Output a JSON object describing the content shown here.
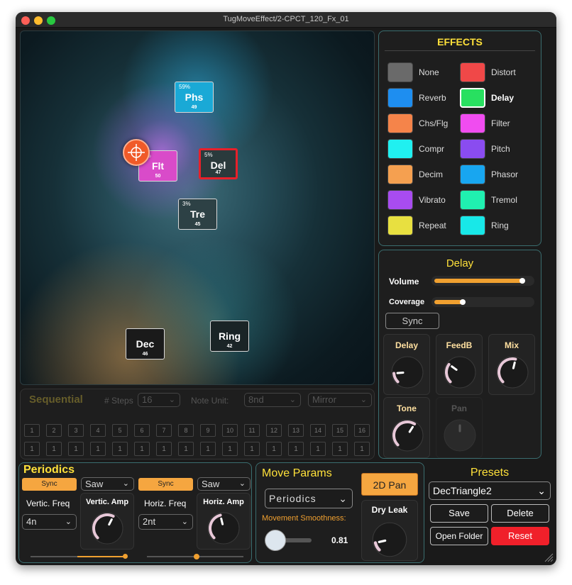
{
  "window": {
    "title": "TugMoveEffect/2-CPCT_120_Fx_01"
  },
  "tiles": [
    {
      "name": "Phs",
      "pct": "59%",
      "num": "49",
      "color": "#1aa9d6"
    },
    {
      "name": "Flt",
      "pct": "3%",
      "num": "50",
      "color": "#d94bc9"
    },
    {
      "name": "Del",
      "pct": "5%",
      "num": "47",
      "color": "#2a3a3c"
    },
    {
      "name": "Tre",
      "pct": "3%",
      "num": "45",
      "color": "#2d4145"
    },
    {
      "name": "Dec",
      "pct": "",
      "num": "46",
      "color": "#1a1a1a"
    },
    {
      "name": "Ring",
      "pct": "",
      "num": "42",
      "color": "#1a2426"
    }
  ],
  "effects": {
    "title": "EFFECTS",
    "items": [
      {
        "label": "None",
        "color": "#6a6a6a"
      },
      {
        "label": "Distort",
        "color": "#f04848"
      },
      {
        "label": "Reverb",
        "color": "#1e8ef0"
      },
      {
        "label": "Delay",
        "color": "#28e060",
        "selected": true
      },
      {
        "label": "Chs/Flg",
        "color": "#f5844a"
      },
      {
        "label": "Filter",
        "color": "#f04cf0"
      },
      {
        "label": "Compr",
        "color": "#20f0f0"
      },
      {
        "label": "Pitch",
        "color": "#8a4cf0"
      },
      {
        "label": "Decim",
        "color": "#f5a050"
      },
      {
        "label": "Phasor",
        "color": "#18a6f0"
      },
      {
        "label": "Vibrato",
        "color": "#a84cf0"
      },
      {
        "label": "Tremol",
        "color": "#20f0b0"
      },
      {
        "label": "Repeat",
        "color": "#e8e040"
      },
      {
        "label": "Ring",
        "color": "#18e8e8"
      }
    ]
  },
  "delay": {
    "title": "Delay",
    "volume_label": "Volume",
    "volume": 0.93,
    "coverage_label": "Coverage",
    "coverage": 0.3,
    "sync_label": "Sync",
    "knobs": [
      {
        "label": "Delay",
        "value": 0.15
      },
      {
        "label": "FeedB",
        "value": 0.3
      },
      {
        "label": "Mix",
        "value": 0.55
      },
      {
        "label": "Tone",
        "value": 0.62
      },
      {
        "label": "Pan",
        "value": 0.5
      }
    ]
  },
  "sequential": {
    "title": "Sequential",
    "steps_label": "# Steps",
    "steps_value": "16",
    "note_unit_label": "Note Unit:",
    "note_unit_value": "8nd",
    "mode_value": "Mirror",
    "steps": [
      "1",
      "2",
      "3",
      "4",
      "5",
      "6",
      "7",
      "8",
      "9",
      "10",
      "11",
      "12",
      "13",
      "14",
      "15",
      "16"
    ],
    "values": [
      "1",
      "1",
      "1",
      "1",
      "1",
      "1",
      "1",
      "1",
      "1",
      "1",
      "1",
      "1",
      "1",
      "1",
      "1",
      "1"
    ]
  },
  "periodics": {
    "title": "Periodics",
    "sync1": "Sync",
    "wave1": "Saw",
    "sync2": "Sync",
    "wave2": "Saw",
    "vfreq_label": "Vertic. Freq",
    "vfreq_value": "4n",
    "vamp_label": "Vertic. Amp",
    "hfreq_label": "Horiz. Freq",
    "hfreq_value": "2nt",
    "hamp_label": "Horiz. Amp"
  },
  "move": {
    "title": "Move Params",
    "pan_button": "2D Pan",
    "mode_value": "Periodics",
    "dry_leak_label": "Dry Leak",
    "smooth_label": "Movement Smoothness:",
    "smooth_value": "0.81"
  },
  "presets": {
    "title": "Presets",
    "current": "DecTriangle2",
    "save": "Save",
    "delete": "Delete",
    "open": "Open Folder",
    "reset": "Reset"
  }
}
